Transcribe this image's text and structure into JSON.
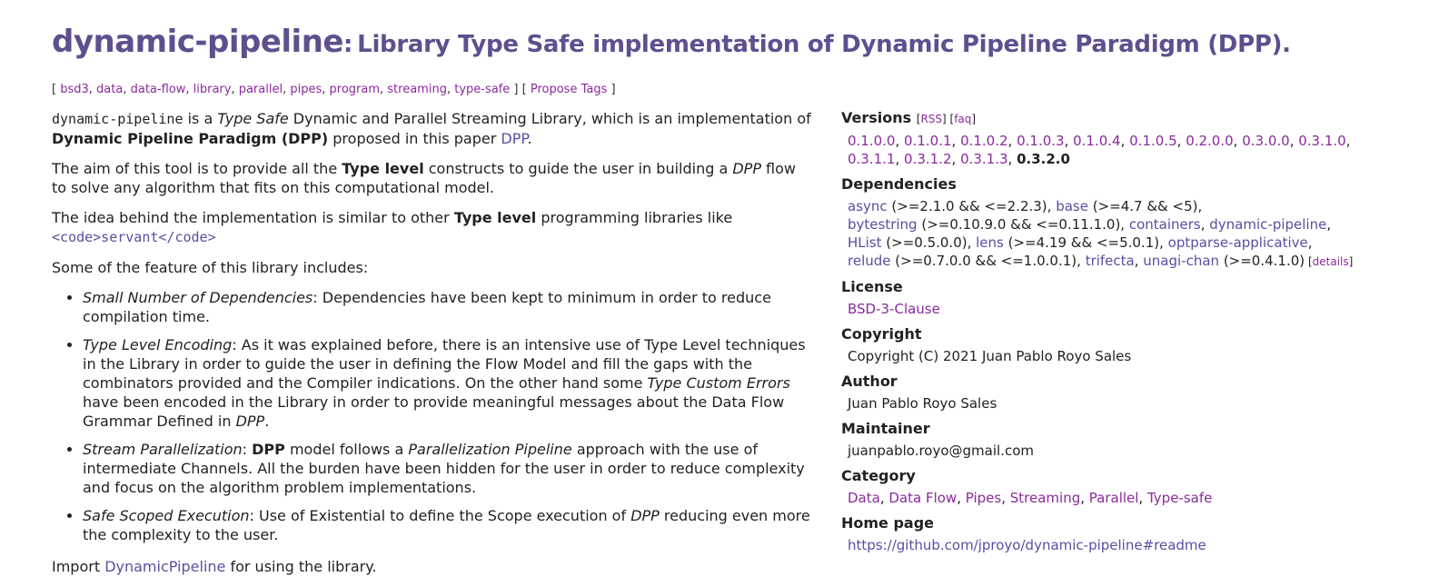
{
  "header": {
    "package_name": "dynamic-pipeline",
    "separator": ":",
    "description": "Library Type Safe implementation of Dynamic Pipeline Paradigm (DPP)."
  },
  "tags": {
    "open": "[",
    "items": [
      "bsd3",
      "data",
      "data-flow",
      "library",
      "parallel",
      "pipes",
      "program",
      "streaming",
      "type-safe"
    ],
    "close": "]",
    "propose_open": "[",
    "propose_label": "Propose Tags",
    "propose_close": "]"
  },
  "description": {
    "p1": {
      "code": "dynamic-pipeline",
      "t1": " is a ",
      "em1": "Type Safe",
      "t2": " Dynamic and Parallel Streaming Library, which is an implementation of ",
      "b1": "Dynamic Pipeline Paradigm (DPP)",
      "t3": " proposed in this paper ",
      "link": "DPP",
      "t4": "."
    },
    "p2": {
      "t1": "The aim of this tool is to provide all the ",
      "b1": "Type level",
      "t2": " constructs to guide the user in building a ",
      "em1": "DPP",
      "t3": " flow to solve any algorithm that fits on this computational model."
    },
    "p3": {
      "t1": "The idea behind the implementation is similar to other ",
      "b1": "Type level",
      "t2": " programming libraries like",
      "link": "<code>servant</code>"
    },
    "p4": "Some of the feature of this library includes:",
    "features": {
      "f1": {
        "em": "Small Number of Dependencies",
        "t1": ": Dependencies have been kept to minimum in order to reduce compilation time."
      },
      "f2": {
        "em": "Type Level Encoding",
        "t1": ": As it was explained before, there is an intensive use of Type Level techniques in the Library in order to guide the user in defining the Flow Model and fill the gaps with the combinators provided and the Compiler indications. On the other hand some ",
        "em2": "Type Custom Errors",
        "t2": " have been encoded in the Library in order to provide meaningful messages about the Data Flow Grammar Defined in ",
        "em3": "DPP",
        "t3": "."
      },
      "f3": {
        "em": "Stream Parallelization",
        "t1": ": ",
        "b1": "DPP",
        "t2": " model follows a ",
        "em2": "Parallelization Pipeline",
        "t3": " approach with the use of intermediate Channels. All the burden have been hidden for the user in order to reduce complexity and focus on the algorithm problem implementations."
      },
      "f4": {
        "em": "Safe Scoped Execution",
        "t1": ": Use of Existential to define the Scope execution of ",
        "em2": "DPP",
        "t2": " reducing even more the complexity to the user."
      }
    },
    "p5": {
      "t1": "Import ",
      "link": "DynamicPipeline",
      "t2": " for using the library."
    }
  },
  "sidebar": {
    "versions": {
      "heading": "Versions",
      "rss": "RSS",
      "faq": "faq",
      "list": [
        "0.1.0.0",
        "0.1.0.1",
        "0.1.0.2",
        "0.1.0.3",
        "0.1.0.4",
        "0.1.0.5",
        "0.2.0.0",
        "0.3.0.0",
        "0.3.1.0",
        "0.3.1.1",
        "0.3.1.2",
        "0.3.1.3"
      ],
      "current": "0.3.2.0"
    },
    "dependencies": {
      "heading": "Dependencies",
      "items": [
        {
          "name": "async",
          "range": "(>=2.1.0 && <=2.2.3)"
        },
        {
          "name": "base",
          "range": "(>=4.7 && <5)"
        },
        {
          "name": "bytestring",
          "range": "(>=0.10.9.0 && <=0.11.1.0)"
        },
        {
          "name": "containers",
          "range": ""
        },
        {
          "name": "dynamic-pipeline",
          "range": ""
        },
        {
          "name": "HList",
          "range": "(>=0.5.0.0)"
        },
        {
          "name": "lens",
          "range": "(>=4.19 && <=5.0.1)"
        },
        {
          "name": "optparse-applicative",
          "range": ""
        },
        {
          "name": "relude",
          "range": "(>=0.7.0.0 && <=1.0.0.1)"
        },
        {
          "name": "trifecta",
          "range": ""
        },
        {
          "name": "unagi-chan",
          "range": "(>=0.4.1.0)"
        }
      ],
      "details": "details"
    },
    "license": {
      "heading": "License",
      "value": "BSD-3-Clause"
    },
    "copyright": {
      "heading": "Copyright",
      "value": "Copyright (C) 2021 Juan Pablo Royo Sales"
    },
    "author": {
      "heading": "Author",
      "value": "Juan Pablo Royo Sales"
    },
    "maintainer": {
      "heading": "Maintainer",
      "value": "juanpablo.royo@gmail.com"
    },
    "category": {
      "heading": "Category",
      "items": [
        "Data",
        "Data Flow",
        "Pipes",
        "Streaming",
        "Parallel",
        "Type-safe"
      ]
    },
    "homepage": {
      "heading": "Home page",
      "value": "https://github.com/jproyo/dynamic-pipeline#readme"
    }
  },
  "colors": {
    "title": "#5e4f8e",
    "link": "#8a2a9c",
    "link_alt": "#5a4ea1",
    "text": "#222222"
  }
}
